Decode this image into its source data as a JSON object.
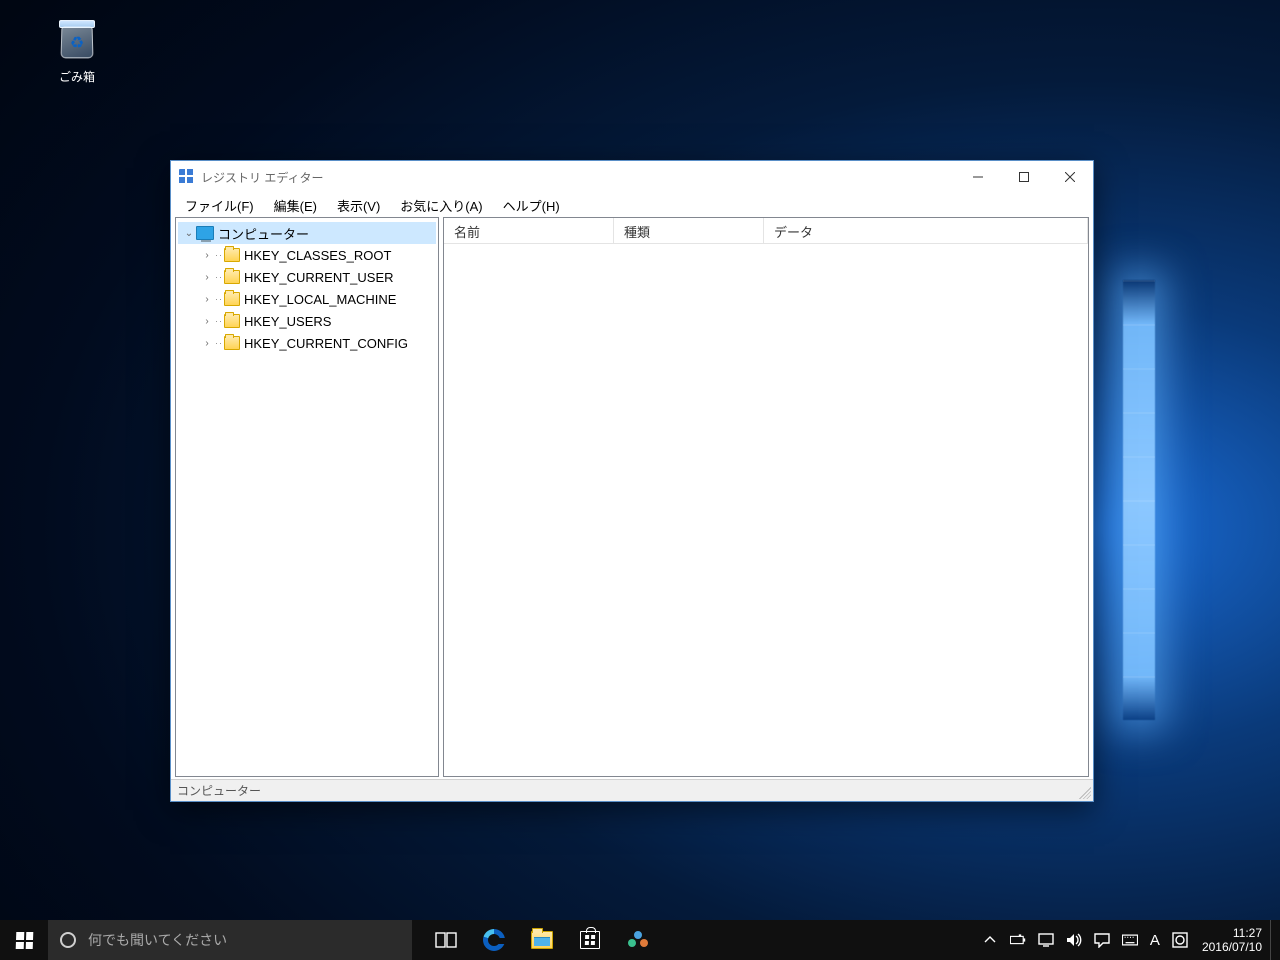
{
  "desktop": {
    "recycle_bin_label": "ごみ箱"
  },
  "window": {
    "title": "レジストリ エディター",
    "menu": {
      "file": "ファイル(F)",
      "edit": "編集(E)",
      "view": "表示(V)",
      "favorites": "お気に入り(A)",
      "help": "ヘルプ(H)"
    },
    "tree": {
      "root": "コンピューター",
      "hives": [
        "HKEY_CLASSES_ROOT",
        "HKEY_CURRENT_USER",
        "HKEY_LOCAL_MACHINE",
        "HKEY_USERS",
        "HKEY_CURRENT_CONFIG"
      ]
    },
    "list_header": {
      "name": "名前",
      "type": "種類",
      "data": "データ"
    },
    "statusbar": "コンピューター"
  },
  "taskbar": {
    "search_placeholder": "何でも聞いてください",
    "ime_mode": "A",
    "clock_time": "11:27",
    "clock_date": "2016/07/10"
  },
  "icons": {
    "recycle_bin": "recycle-bin-icon",
    "regedit": "regedit-icon",
    "minimize": "minimize-icon",
    "maximize": "maximize-icon",
    "close": "close-icon",
    "tree_expand_open": "chevron-down-icon",
    "tree_expand_closed": "chevron-right-icon",
    "computer": "computer-icon",
    "folder": "folder-icon",
    "start": "windows-start-icon",
    "cortana": "cortana-circle-icon",
    "task_view": "task-view-icon",
    "edge": "edge-icon",
    "explorer": "file-explorer-icon",
    "store": "store-icon",
    "people": "people-icon",
    "tray_up": "chevron-up-icon",
    "battery": "battery-icon",
    "network": "network-icon",
    "volume": "volume-icon",
    "action_center": "action-center-icon",
    "keyboard": "keyboard-icon",
    "ime_pad": "ime-pad-icon"
  }
}
